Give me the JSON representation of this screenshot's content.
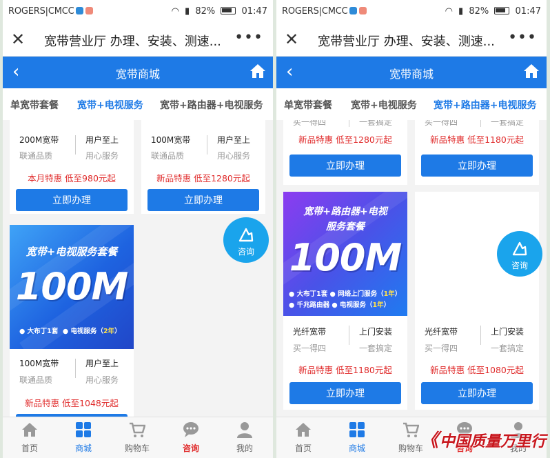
{
  "status_bar": {
    "carrier": "ROGERS|CMCC",
    "battery": "82%",
    "time": "01:47"
  },
  "title_bar": {
    "title": "宽带营业厅 办理、安装、测速...",
    "close_icon": "close-icon",
    "more_icon": "more-icon"
  },
  "header": {
    "title": "宽带商城",
    "back_icon": "chevron-left-icon",
    "home_icon": "home-icon"
  },
  "tabs": [
    {
      "label": "单宽带套餐"
    },
    {
      "label": "宽带+电视服务"
    },
    {
      "label": "宽带+路由器+电视服务"
    }
  ],
  "screen1": {
    "active_tab": 1,
    "top_cards": [
      {
        "title": "200M宽带",
        "sub": "联通品质",
        "right": "用户至上",
        "right_sub": "用心服务",
        "promo": "本月特惠 低至980元起",
        "button": "立即办理"
      },
      {
        "title": "100M宽带",
        "sub": "联通品质",
        "right": "用户至上",
        "right_sub": "用心服务",
        "promo": "新品特惠 低至1280元起",
        "button": "立即办理"
      }
    ],
    "banner_card": {
      "banner_title": "宽带+电视服务套餐",
      "banner_speed": "100M",
      "features": [
        "大布丁1套",
        "电视服务（",
        "2年",
        "）"
      ],
      "title": "100M宽带",
      "sub": "联通品质",
      "right": "用户至上",
      "right_sub": "用心服务",
      "promo": "新品特惠 低至1048元起"
    }
  },
  "screen2": {
    "active_tab": 2,
    "top_cards": [
      {
        "cut_sub": "买一得四",
        "cut_right": "一套搞定",
        "promo": "新品特惠 低至1280元起",
        "button": "立即办理"
      },
      {
        "cut_sub": "买一得四",
        "cut_right": "一套搞定",
        "promo": "新品特惠 低至1180元起",
        "button": "立即办理"
      }
    ],
    "cards": [
      {
        "banner_title1": "宽带+路由器+电视",
        "banner_title2": "服务套餐",
        "banner_speed": "100M",
        "feature_line1": [
          "大布丁1套",
          "网络上门服务（",
          "1年",
          "）"
        ],
        "feature_line2": [
          "千兆路由器",
          "电视服务（",
          "1年",
          "）"
        ],
        "title": "光纤宽带",
        "sub": "买一得四",
        "right": "上门安装",
        "right_sub": "一套搞定",
        "promo": "新品特惠 低至1180元起",
        "button": "立即办理"
      },
      {
        "title": "光纤宽带",
        "sub": "买一得四",
        "right": "上门安装",
        "right_sub": "一套搞定",
        "promo": "新品特惠 低至1080元起",
        "button": "立即办理"
      }
    ]
  },
  "consult": {
    "label": "咨询",
    "icon": "consult-icon"
  },
  "bottom_nav": [
    {
      "label": "首页",
      "icon": "home-icon"
    },
    {
      "label": "商城",
      "icon": "grid-icon"
    },
    {
      "label": "购物车",
      "icon": "cart-icon"
    },
    {
      "label": "咨询",
      "icon": "chat-icon"
    },
    {
      "label": "我的",
      "icon": "user-icon"
    }
  ],
  "watermark": "中国质量万里行",
  "colors": {
    "brand_blue": "#1e7ae6",
    "promo_red": "#e02b2b",
    "consult_blue": "#1aa4ec"
  }
}
